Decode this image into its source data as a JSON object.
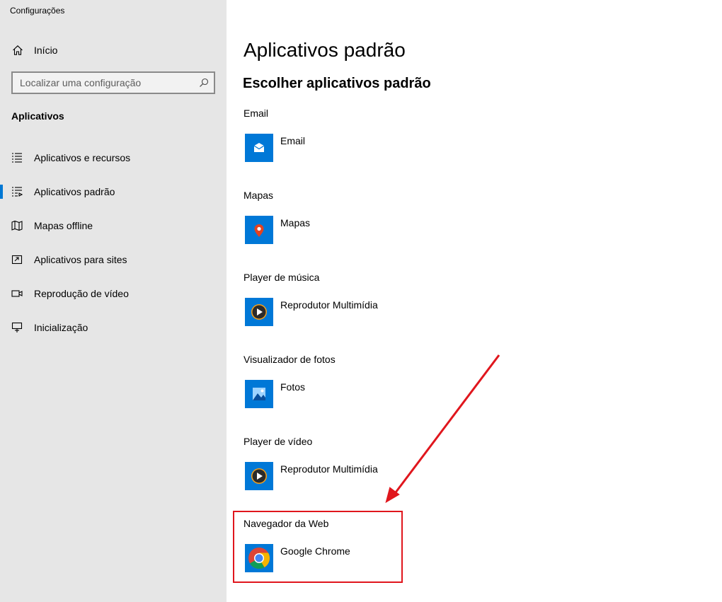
{
  "window": {
    "title": "Configurações"
  },
  "sidebar": {
    "home_label": "Início",
    "search": {
      "placeholder": "Localizar uma configuração",
      "value": ""
    },
    "section_title": "Aplicativos",
    "items": [
      {
        "label": "Aplicativos e recursos",
        "icon": "list-icon",
        "active": false
      },
      {
        "label": "Aplicativos padrão",
        "icon": "default-apps-icon",
        "active": true
      },
      {
        "label": "Mapas offline",
        "icon": "map-icon",
        "active": false
      },
      {
        "label": "Aplicativos para sites",
        "icon": "open-in-app-icon",
        "active": false
      },
      {
        "label": "Reprodução de vídeo",
        "icon": "video-icon",
        "active": false
      },
      {
        "label": "Inicialização",
        "icon": "startup-icon",
        "active": false
      }
    ]
  },
  "main": {
    "title": "Aplicativos padrão",
    "subtitle": "Escolher aplicativos padrão",
    "defaults": [
      {
        "category": "Email",
        "app": "Email",
        "icon": "mail-icon",
        "tile_color": "#0078d7"
      },
      {
        "category": "Mapas",
        "app": "Mapas",
        "icon": "map-pin-icon",
        "tile_color": "#0078d7"
      },
      {
        "category": "Player de música",
        "app": "Reprodutor Multimídia",
        "icon": "media-player-icon",
        "tile_color": "#0078d7"
      },
      {
        "category": "Visualizador de fotos",
        "app": "Fotos",
        "icon": "photos-icon",
        "tile_color": "#0078d7"
      },
      {
        "category": "Player de vídeo",
        "app": "Reprodutor Multimídia",
        "icon": "media-player-icon",
        "tile_color": "#0078d7"
      },
      {
        "category": "Navegador da Web",
        "app": "Google Chrome",
        "icon": "chrome-icon",
        "tile_color": "#0078d7"
      }
    ]
  },
  "annotation": {
    "color": "#e0161d"
  },
  "colors": {
    "accent": "#0078d4",
    "sidebar_bg": "#e6e6e6"
  }
}
